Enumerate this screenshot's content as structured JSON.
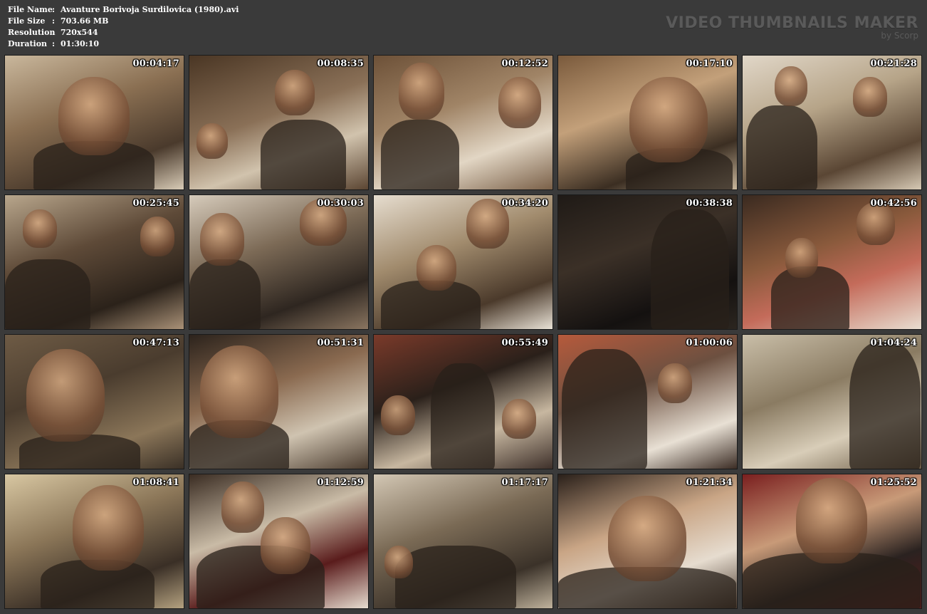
{
  "info": {
    "rows": [
      {
        "label": "File Name",
        "sep": ":",
        "value": "Avanture Borivoja Surdilovica (1980).avi"
      },
      {
        "label": "File Size",
        "sep": ":",
        "value": "703.66 MB"
      },
      {
        "label": "Resolution",
        "sep": ":",
        "value": "720x544"
      },
      {
        "label": "Duration",
        "sep": ":",
        "value": "01:30:10"
      }
    ]
  },
  "brand": {
    "title": "VIDEO THUMBNAILS MAKER",
    "subtitle": "by Scorp"
  },
  "thumbnails": [
    {
      "timestamp": "00:04:17"
    },
    {
      "timestamp": "00:08:35"
    },
    {
      "timestamp": "00:12:52"
    },
    {
      "timestamp": "00:17:10"
    },
    {
      "timestamp": "00:21:28"
    },
    {
      "timestamp": "00:25:45"
    },
    {
      "timestamp": "00:30:03"
    },
    {
      "timestamp": "00:34:20"
    },
    {
      "timestamp": "00:38:38"
    },
    {
      "timestamp": "00:42:56"
    },
    {
      "timestamp": "00:47:13"
    },
    {
      "timestamp": "00:51:31"
    },
    {
      "timestamp": "00:55:49"
    },
    {
      "timestamp": "01:00:06"
    },
    {
      "timestamp": "01:04:24"
    },
    {
      "timestamp": "01:08:41"
    },
    {
      "timestamp": "01:12:59"
    },
    {
      "timestamp": "01:17:17"
    },
    {
      "timestamp": "01:21:34"
    },
    {
      "timestamp": "01:25:52"
    }
  ]
}
